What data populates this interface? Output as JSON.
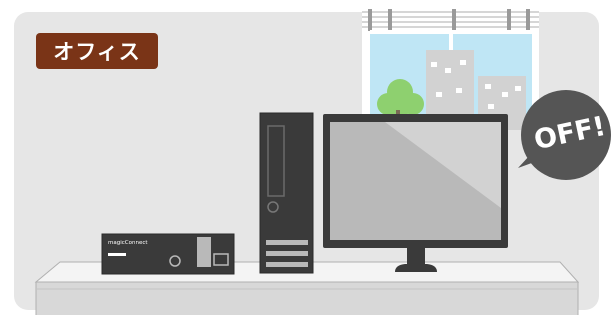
{
  "badge": {
    "label": "オフィス"
  },
  "monitor_status": {
    "label": "OFF!"
  },
  "device": {
    "brand": "magicConnect"
  },
  "colors": {
    "badge_bg": "#7a3417",
    "bubble_bg": "#555555",
    "background": "#e6e6e6",
    "desk_top": "#f2f2f2",
    "device_body": "#3b3b3b",
    "monitor_screen": "#b9b9b9",
    "sky": "#bfe6f5"
  },
  "icons": [
    "window-icon",
    "building-icon",
    "tree-icon",
    "desk-icon",
    "desktop-tower-icon",
    "monitor-icon",
    "mini-pc-icon"
  ]
}
